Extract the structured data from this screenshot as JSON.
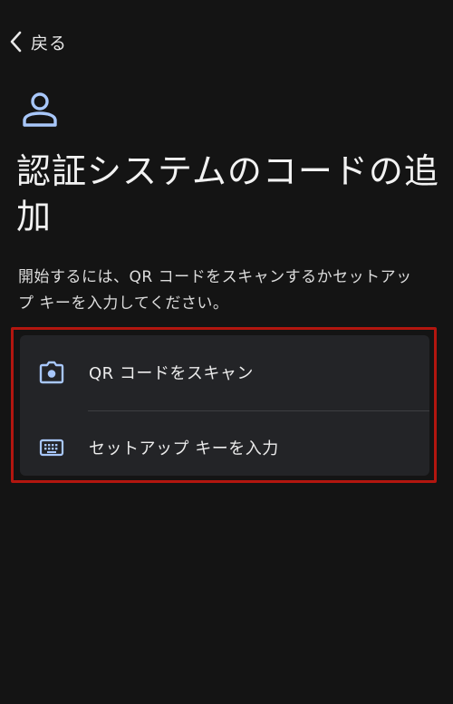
{
  "header": {
    "back_label": "戻る",
    "back_icon": "chevron-left-icon"
  },
  "main": {
    "hero_icon": "person-icon",
    "title": "認証システムのコードの追加",
    "description": "開始するには、QR コードをスキャンするかセットアップ キーを入力してください。"
  },
  "options": [
    {
      "label": "QR コードをスキャン",
      "icon": "camera-icon"
    },
    {
      "label": "セットアップ キーを入力",
      "icon": "keyboard-icon"
    }
  ],
  "colors": {
    "background": "#141414",
    "card": "#232427",
    "accent_icon": "#a8c7fa",
    "highlight_border": "#b3160f"
  }
}
